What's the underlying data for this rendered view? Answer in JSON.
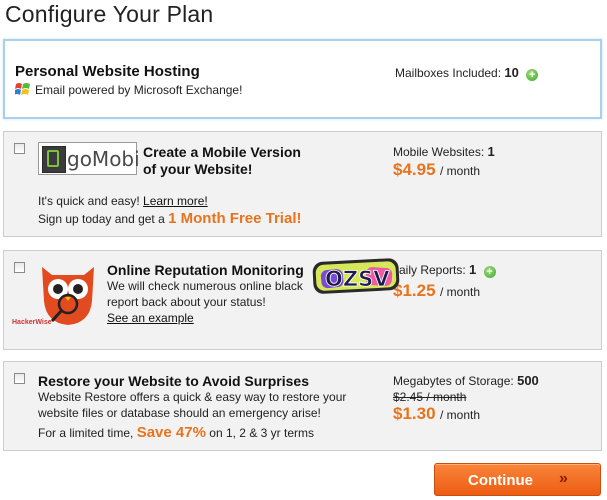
{
  "title": "Configure Your Plan",
  "plan": {
    "name": "Personal Website Hosting",
    "email_note": "Email powered by Microsoft Exchange!",
    "mailboxes_label": "Mailboxes Included:",
    "mailboxes_value": "10"
  },
  "gomobi": {
    "logo_text": "goMobi",
    "heading_line1": "Create a Mobile Version",
    "heading_line2": "of your Website!",
    "line1": "It's quick and easy!",
    "learn_more": "Learn more!",
    "line2_prefix": "Sign up today and get a",
    "trial": "1 Month Free Trial!",
    "metric_label": "Mobile Websites:",
    "metric_value": "1",
    "price": "$4.95",
    "per": "/ month"
  },
  "reputation": {
    "logo_caption": "HackerWise",
    "heading": "Online Reputation Monitoring",
    "desc1": "We will check numerous online black",
    "desc2": "report back about your status!",
    "example_link": "See an example",
    "metric_label": "aily Reports:",
    "metric_value": "1",
    "price": "$1.25",
    "per": "/ month",
    "sticker_text": "OZSV"
  },
  "restore": {
    "heading": "Restore your Website to Avoid Surprises",
    "desc1": "Website Restore offers a quick & easy way to restore your",
    "desc2": "website files or database should an emergency arise!",
    "promo_prefix": "For a limited time,",
    "promo_highlight": "Save 47%",
    "promo_suffix": "on 1, 2 & 3 yr terms",
    "metric_label": "Megabytes of Storage:",
    "metric_value": "500",
    "old_price": "$2.45 / month",
    "price": "$1.30",
    "per": "/ month"
  },
  "continue_button": {
    "label": "Continue",
    "chevron": "»"
  },
  "colors": {
    "accent_orange": "#e8731d",
    "button_orange": "#ec5d12",
    "panel_border_blue": "#a9cfea",
    "plus_green": "#3fa82a"
  }
}
